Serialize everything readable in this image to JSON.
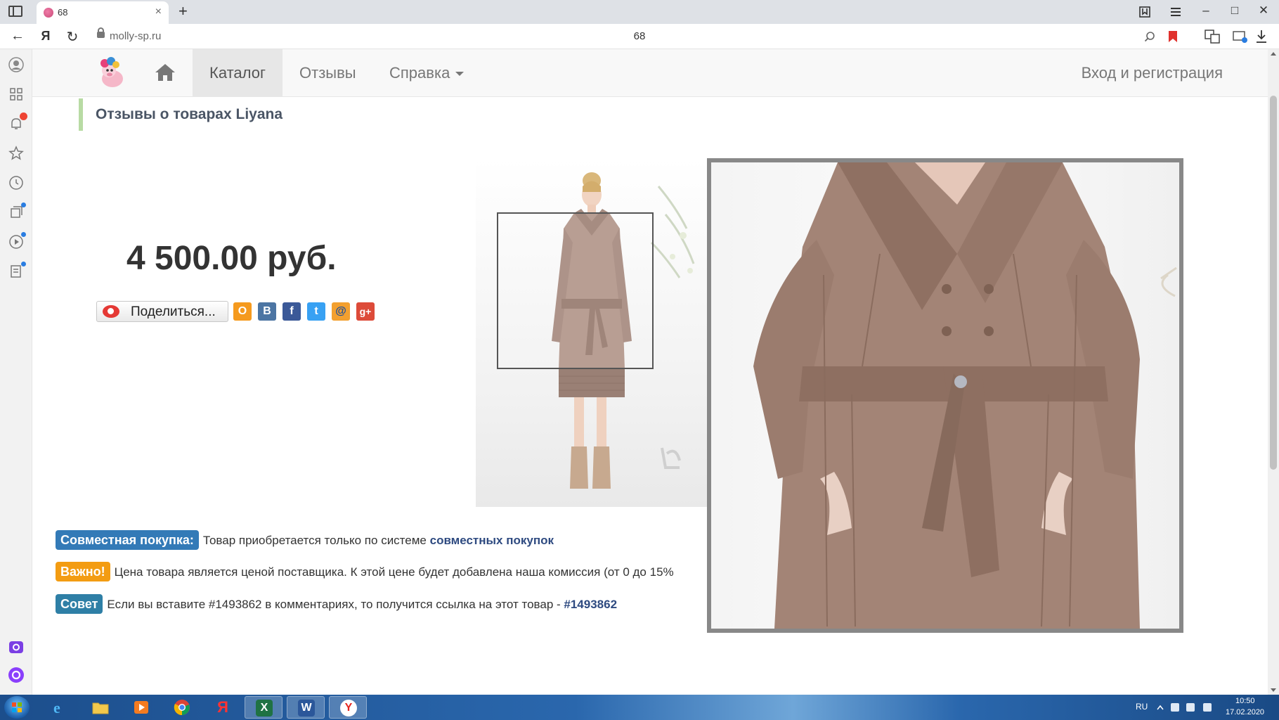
{
  "browser": {
    "tab_title": "68",
    "tab_close": "×",
    "new_tab": "+",
    "url_domain": "molly-sp.ru",
    "page_title": "68",
    "back": "←",
    "yandex_btn": "Я",
    "reload": "↻",
    "minimize": "–",
    "maximize": "□",
    "close": "✕"
  },
  "site_nav": {
    "catalog": "Каталог",
    "reviews": "Отзывы",
    "help": "Справка",
    "login": "Вход и регистрация"
  },
  "page": {
    "reviews_header": "Отзывы о товарах Liyana",
    "price": "4 500.00 руб.",
    "share_label": "Поделиться...",
    "social": {
      "odnoklassniki": "О",
      "vkontakte": "В",
      "facebook": "f",
      "twitter": "t",
      "mail": "@",
      "googleplus": "g+"
    }
  },
  "info": {
    "joint_label": "Совместная покупка:",
    "joint_text": "Товар приобретается только по системе ",
    "joint_link": "совместных покупок",
    "important_label": "Важно!",
    "important_text": "Цена товара является ценой поставщика. К этой цене будет добавлена наша комиссия (от 0 до 15%",
    "tip_label": "Совет",
    "tip_text": "Если вы вставите #1493862 в комментариях, то получится ссылка на этот товар - ",
    "tip_link": "#1493862"
  },
  "taskbar": {
    "lang": "RU",
    "time": "10:50",
    "date": "17.02.2020",
    "excel": "X",
    "word": "W",
    "yandex": "Я",
    "yandex_browser": "Y"
  },
  "colors": {
    "label_blue": "#337ab7",
    "label_orange": "#f39c12",
    "coat": "#a38476"
  }
}
